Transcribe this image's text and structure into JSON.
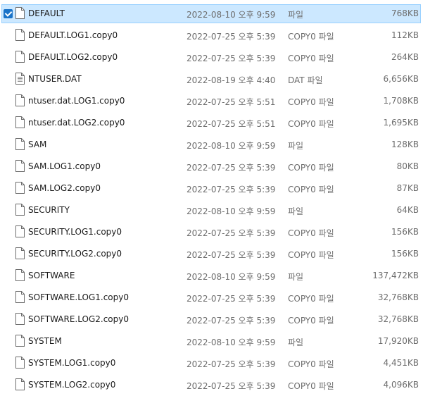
{
  "files": [
    {
      "name": "DEFAULT",
      "modified": "2022-08-10 오후 9:59",
      "type": "파일",
      "size": "768KB",
      "icon": "blank-file-icon",
      "selected": true
    },
    {
      "name": "DEFAULT.LOG1.copy0",
      "modified": "2022-07-25 오후 5:39",
      "type": "COPY0 파일",
      "size": "112KB",
      "icon": "blank-file-icon",
      "selected": false
    },
    {
      "name": "DEFAULT.LOG2.copy0",
      "modified": "2022-07-25 오후 5:39",
      "type": "COPY0 파일",
      "size": "264KB",
      "icon": "blank-file-icon",
      "selected": false
    },
    {
      "name": "NTUSER.DAT",
      "modified": "2022-08-19 오후 4:40",
      "type": "DAT 파일",
      "size": "6,656KB",
      "icon": "lined-file-icon",
      "selected": false
    },
    {
      "name": "ntuser.dat.LOG1.copy0",
      "modified": "2022-07-25 오후 5:51",
      "type": "COPY0 파일",
      "size": "1,708KB",
      "icon": "blank-file-icon",
      "selected": false
    },
    {
      "name": "ntuser.dat.LOG2.copy0",
      "modified": "2022-07-25 오후 5:51",
      "type": "COPY0 파일",
      "size": "1,695KB",
      "icon": "blank-file-icon",
      "selected": false
    },
    {
      "name": "SAM",
      "modified": "2022-08-10 오후 9:59",
      "type": "파일",
      "size": "128KB",
      "icon": "blank-file-icon",
      "selected": false
    },
    {
      "name": "SAM.LOG1.copy0",
      "modified": "2022-07-25 오후 5:39",
      "type": "COPY0 파일",
      "size": "80KB",
      "icon": "blank-file-icon",
      "selected": false
    },
    {
      "name": "SAM.LOG2.copy0",
      "modified": "2022-07-25 오후 5:39",
      "type": "COPY0 파일",
      "size": "87KB",
      "icon": "blank-file-icon",
      "selected": false
    },
    {
      "name": "SECURITY",
      "modified": "2022-08-10 오후 9:59",
      "type": "파일",
      "size": "64KB",
      "icon": "blank-file-icon",
      "selected": false
    },
    {
      "name": "SECURITY.LOG1.copy0",
      "modified": "2022-07-25 오후 5:39",
      "type": "COPY0 파일",
      "size": "156KB",
      "icon": "blank-file-icon",
      "selected": false
    },
    {
      "name": "SECURITY.LOG2.copy0",
      "modified": "2022-07-25 오후 5:39",
      "type": "COPY0 파일",
      "size": "156KB",
      "icon": "blank-file-icon",
      "selected": false
    },
    {
      "name": "SOFTWARE",
      "modified": "2022-08-10 오후 9:59",
      "type": "파일",
      "size": "137,472KB",
      "icon": "blank-file-icon",
      "selected": false
    },
    {
      "name": "SOFTWARE.LOG1.copy0",
      "modified": "2022-07-25 오후 5:39",
      "type": "COPY0 파일",
      "size": "32,768KB",
      "icon": "blank-file-icon",
      "selected": false
    },
    {
      "name": "SOFTWARE.LOG2.copy0",
      "modified": "2022-07-25 오후 5:39",
      "type": "COPY0 파일",
      "size": "32,768KB",
      "icon": "blank-file-icon",
      "selected": false
    },
    {
      "name": "SYSTEM",
      "modified": "2022-08-10 오후 9:59",
      "type": "파일",
      "size": "17,920KB",
      "icon": "blank-file-icon",
      "selected": false
    },
    {
      "name": "SYSTEM.LOG1.copy0",
      "modified": "2022-07-25 오후 5:39",
      "type": "COPY0 파일",
      "size": "4,451KB",
      "icon": "blank-file-icon",
      "selected": false
    },
    {
      "name": "SYSTEM.LOG2.copy0",
      "modified": "2022-07-25 오후 5:39",
      "type": "COPY0 파일",
      "size": "4,096KB",
      "icon": "blank-file-icon",
      "selected": false
    }
  ],
  "colors": {
    "selection_bg": "#cce8ff",
    "selection_border": "#99d1ff",
    "checkbox": "#1a73c8",
    "secondary_text": "#6d6d6d"
  }
}
